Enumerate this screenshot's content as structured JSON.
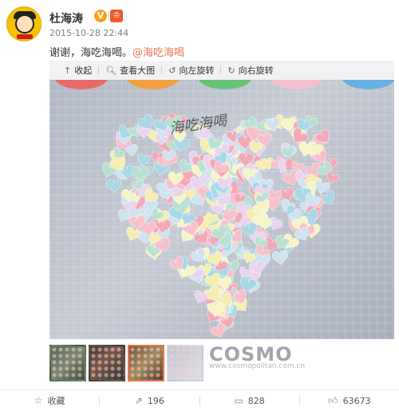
{
  "user": {
    "name": "杜海涛",
    "verified_icon": "verified-v-icon",
    "badge_icon": "member-badge-icon"
  },
  "post": {
    "timestamp": "2015-10-28 22:44",
    "text": "谢谢，海吃海喝。",
    "mention": "@海吃海喝"
  },
  "toolbar": {
    "collapse": "收起",
    "view_large": "查看大图",
    "rotate_left": "向左旋转",
    "rotate_right": "向右旋转"
  },
  "photo": {
    "signature": "海吃海喝",
    "heart_colors": [
      "#f4a9b8",
      "#f7c1cc",
      "#b9e0d3",
      "#f6eeb0",
      "#cfe2f0",
      "#e8d4ef",
      "#f5f5c8",
      "#a9d8e8"
    ]
  },
  "thumbnails": [
    {
      "selected": false
    },
    {
      "selected": false
    },
    {
      "selected": true
    },
    {
      "selected": false
    }
  ],
  "watermark": {
    "brand": "COSMO",
    "url": "www.cosmopolitan.com.cn"
  },
  "footer": {
    "favorite": "收藏",
    "reposts": "196",
    "comments": "828",
    "likes": "63673"
  }
}
